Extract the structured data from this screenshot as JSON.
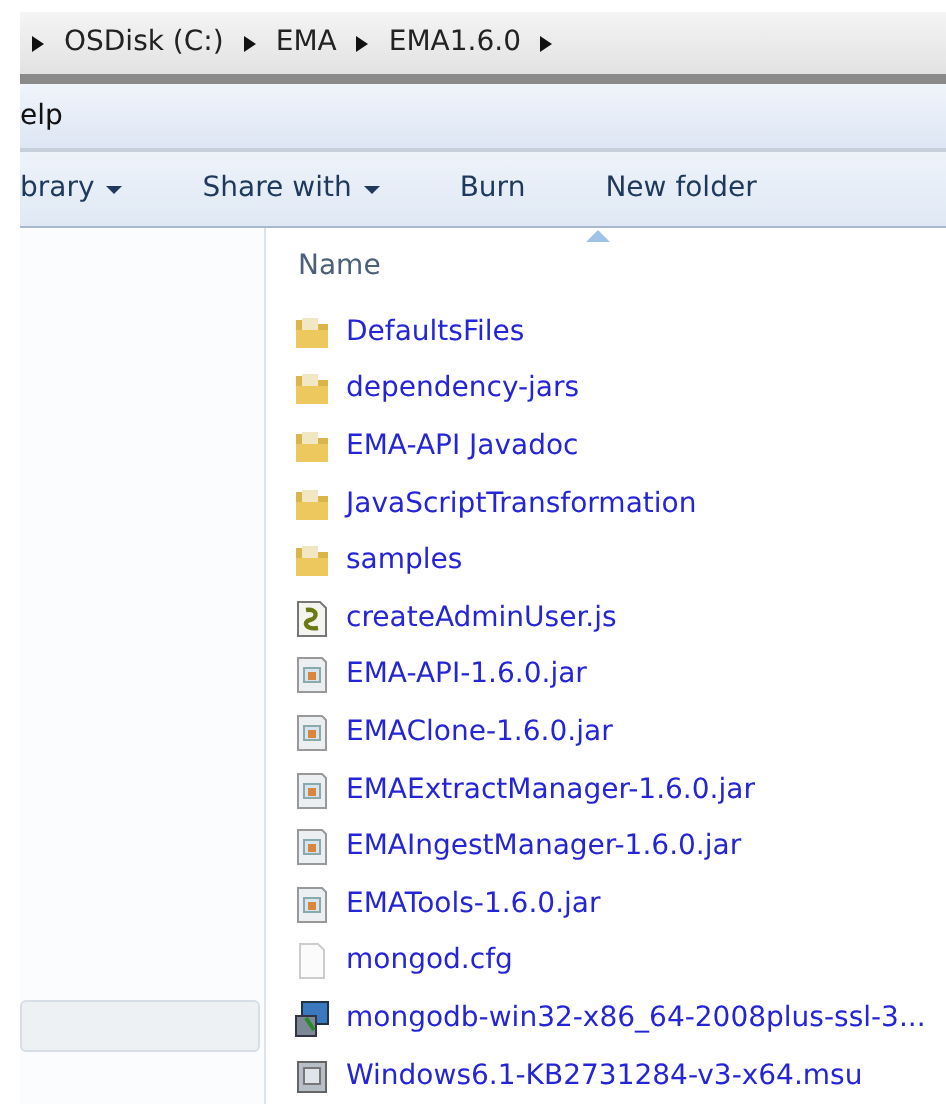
{
  "address_bar": {
    "crumbs": [
      "OSDisk (C:)",
      "EMA",
      "EMA1.6.0"
    ]
  },
  "menu_bar": {
    "items": [
      "elp"
    ]
  },
  "toolbar": {
    "items": [
      {
        "label": "brary",
        "dropdown": true
      },
      {
        "label": "Share with",
        "dropdown": true
      },
      {
        "label": "Burn",
        "dropdown": false
      },
      {
        "label": "New folder",
        "dropdown": false
      }
    ]
  },
  "nav_pane": {
    "items": [
      {
        "selected": true
      }
    ]
  },
  "file_list": {
    "column": "Name",
    "files": [
      {
        "name": "DefaultsFiles",
        "kind": "folder"
      },
      {
        "name": "dependency-jars",
        "kind": "folder"
      },
      {
        "name": "EMA-API Javadoc",
        "kind": "folder"
      },
      {
        "name": "JavaScriptTransformation",
        "kind": "folder"
      },
      {
        "name": "samples",
        "kind": "folder"
      },
      {
        "name": "createAdminUser.js",
        "kind": "script"
      },
      {
        "name": "EMA-API-1.6.0.jar",
        "kind": "jar"
      },
      {
        "name": "EMAClone-1.6.0.jar",
        "kind": "jar"
      },
      {
        "name": "EMAExtractManager-1.6.0.jar",
        "kind": "jar"
      },
      {
        "name": "EMAIngestManager-1.6.0.jar",
        "kind": "jar"
      },
      {
        "name": "EMATools-1.6.0.jar",
        "kind": "jar"
      },
      {
        "name": "mongod.cfg",
        "kind": "file"
      },
      {
        "name": "mongodb-win32-x86_64-2008plus-ssl-3...",
        "kind": "installer"
      },
      {
        "name": "Windows6.1-KB2731284-v3-x64.msu",
        "kind": "package"
      }
    ]
  }
}
